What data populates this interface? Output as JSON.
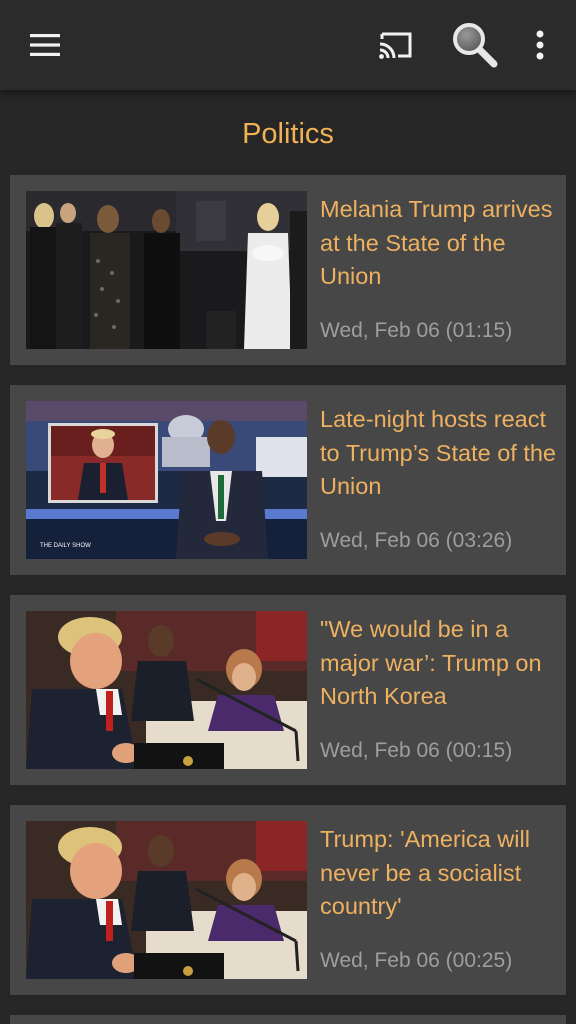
{
  "toolbar": {
    "icons": [
      "menu-icon",
      "cast-icon",
      "search-icon",
      "more-vert-icon"
    ]
  },
  "section": {
    "title": "Politics"
  },
  "articles": [
    {
      "title": "Melania Trump arrives at the State of the Union",
      "date": "Wed, Feb 06 (01:15)"
    },
    {
      "title": "Late-night hosts react to Trump’s State of the Union",
      "date": "Wed, Feb 06 (03:26)",
      "thumb_caption": "THE DAILY SHOW"
    },
    {
      "title": "\"We would be in a major war’: Trump on North Korea",
      "date": "Wed, Feb 06 (00:15)"
    },
    {
      "title": "Trump: 'America will never be a socialist country'",
      "date": "Wed, Feb 06 (00:25)"
    }
  ],
  "colors": {
    "accent": "#f0b255",
    "card_background": "#474747",
    "app_background": "#262626",
    "date_text": "#9e9e9e"
  }
}
